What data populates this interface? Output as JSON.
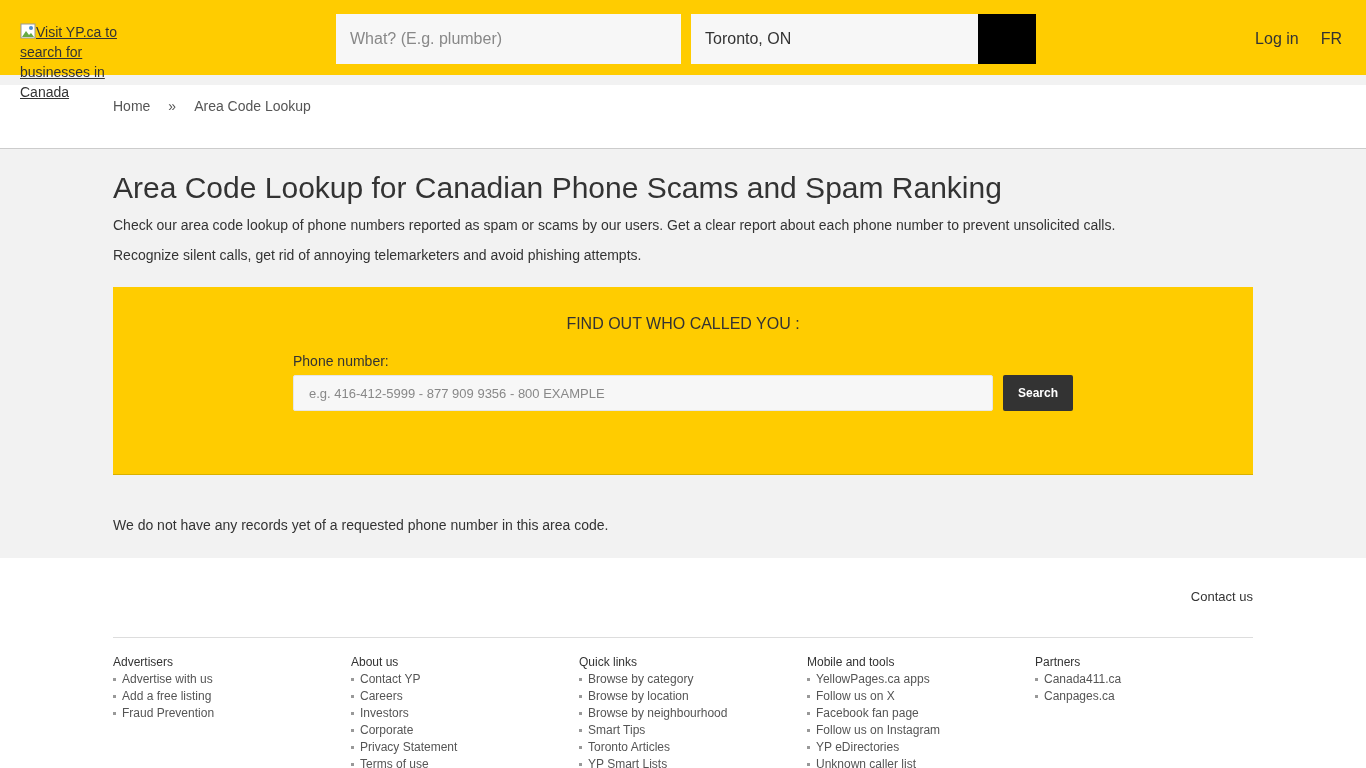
{
  "header": {
    "logo_alt": "Visit YP.ca to search for businesses in Canada",
    "what_placeholder": "What? (E.g. plumber)",
    "where_value": "Toronto, ON",
    "links": [
      "Log in",
      "FR"
    ]
  },
  "breadcrumb": {
    "items": [
      "Home",
      "Area Code Lookup"
    ],
    "separator": "»"
  },
  "title": "Area Code Lookup for Canadian Phone Scams and Spam Ranking",
  "intro": [
    "Check our area code lookup of phone numbers reported as spam or scams by our users. Get a clear report about each phone number to prevent unsolicited calls.",
    "Recognize silent calls, get rid of annoying telemarketers and avoid phishing attempts."
  ],
  "lookup": {
    "heading": "FIND OUT WHO CALLED YOU :",
    "label": "Phone number:",
    "placeholder": "e.g. 416-412-5999 - 877 909 9356 - 800 EXAMPLE",
    "button": "Search"
  },
  "notice": "We do not have any records yet of a requested phone number in this area code.",
  "footer": {
    "contact": "Contact us",
    "columns": [
      {
        "title": "Advertisers",
        "items": [
          "Advertise with us",
          "Add a free listing",
          "Fraud Prevention"
        ]
      },
      {
        "title": "About us",
        "items": [
          "Contact YP",
          "Careers",
          "Investors",
          "Corporate",
          "Privacy Statement",
          "Terms of use"
        ]
      },
      {
        "title": "Quick links",
        "items": [
          "Browse by category",
          "Browse by location",
          "Browse by neighbourhood",
          "Smart Tips",
          "Toronto Articles",
          "YP Smart Lists"
        ]
      },
      {
        "title": "Mobile and tools",
        "items": [
          "YellowPages.ca apps",
          "Follow us on X",
          "Facebook fan page",
          "Follow us on Instagram",
          "YP eDirectories",
          "Unknown caller list"
        ]
      },
      {
        "title": "Partners",
        "items": [
          "Canada411.ca",
          "Canpages.ca"
        ]
      }
    ]
  }
}
